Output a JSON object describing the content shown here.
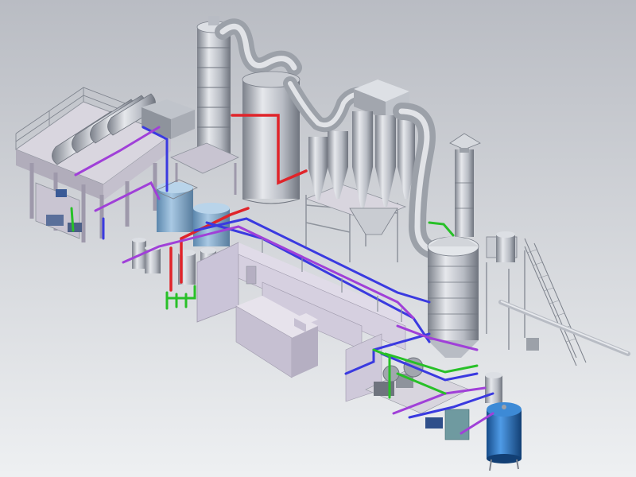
{
  "scene": {
    "subject": "isometric-3d-plant-layout",
    "colors": {
      "background_top": "#b9bcc3",
      "background_bottom": "#eef0f2",
      "steel_light": "#e6e8ec",
      "steel_mid": "#b8bcc4",
      "steel_dark": "#7c818b",
      "concrete": "#d4d0dc",
      "concrete_dark": "#9e99ab",
      "pipe_red": "#e0242a",
      "pipe_blue": "#3a3ae0",
      "pipe_purple": "#a040d8",
      "pipe_green": "#28c028",
      "tank_blue": "#2b78c9",
      "tank_blue_dark": "#164c8a",
      "frame_grey": "#8e939c"
    }
  }
}
